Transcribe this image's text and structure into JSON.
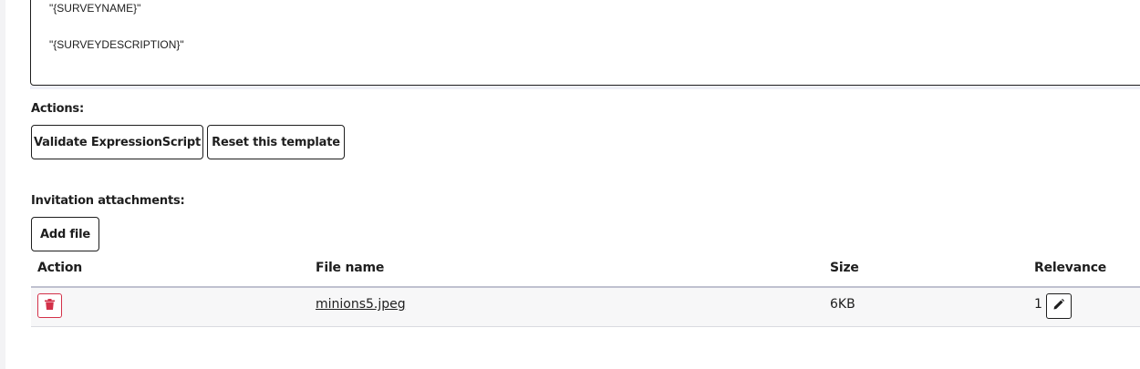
{
  "editor": {
    "line1": "\"{SURVEYNAME}\"",
    "line2": "\"{SURVEYDESCRIPTION}\""
  },
  "actions": {
    "label": "Actions:",
    "validate_label": "Validate ExpressionScript",
    "reset_label": "Reset this template"
  },
  "attachments": {
    "label": "Invitation attachments:",
    "add_file_label": "Add file",
    "columns": [
      "Action",
      "File name",
      "Size",
      "Relevance"
    ],
    "rows": [
      {
        "action_icon": "trash-icon",
        "file_name": "minions5.jpeg",
        "size": "6KB",
        "relevance": "1",
        "edit_icon": "pencil-icon"
      }
    ]
  },
  "colors": {
    "text": "#1e1e1e",
    "danger": "#d33149",
    "row_bg": "#f7f7f8",
    "header_rule": "#bfc1cf"
  }
}
